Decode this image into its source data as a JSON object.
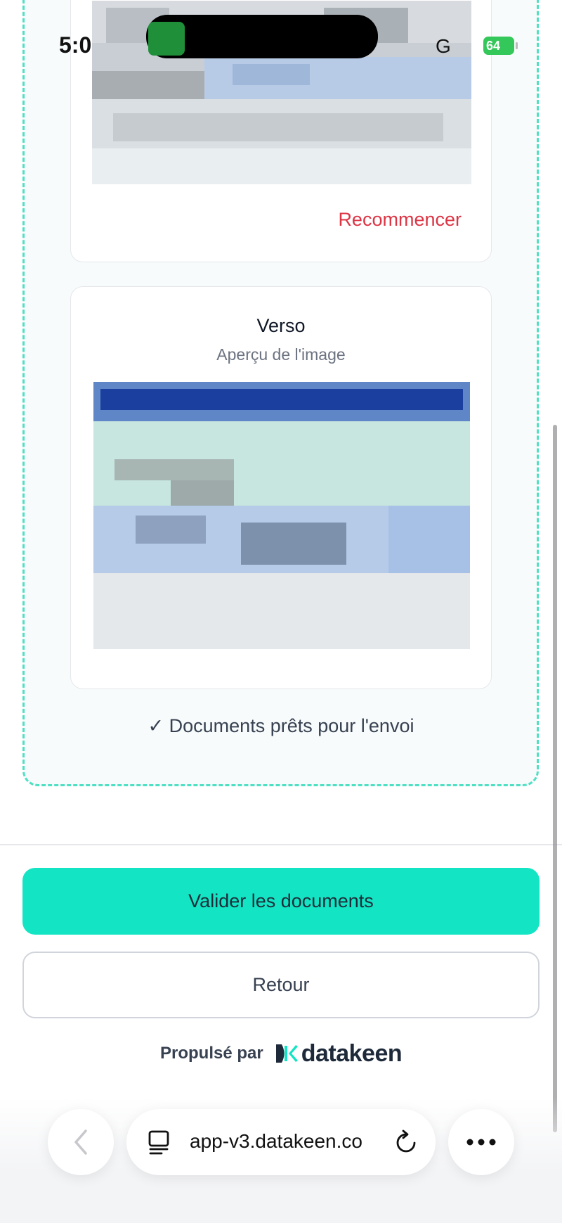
{
  "status_bar": {
    "time": "5:0",
    "network": "G",
    "battery": "64"
  },
  "recto_card": {
    "restart_label": "Recommencer"
  },
  "verso_card": {
    "title": "Verso",
    "subtitle": "Aperçu de l'image"
  },
  "ready_message": "✓ Documents prêts pour l'envoi",
  "actions": {
    "validate_label": "Valider les documents",
    "back_label": "Retour"
  },
  "footer": {
    "powered_by": "Propulsé par",
    "brand": "datakeen"
  },
  "browser": {
    "url": "app-v3.datakeen.co"
  },
  "colors": {
    "accent": "#13e4c3",
    "dashed_border": "#4fe0c4",
    "danger": "#dc3545"
  }
}
